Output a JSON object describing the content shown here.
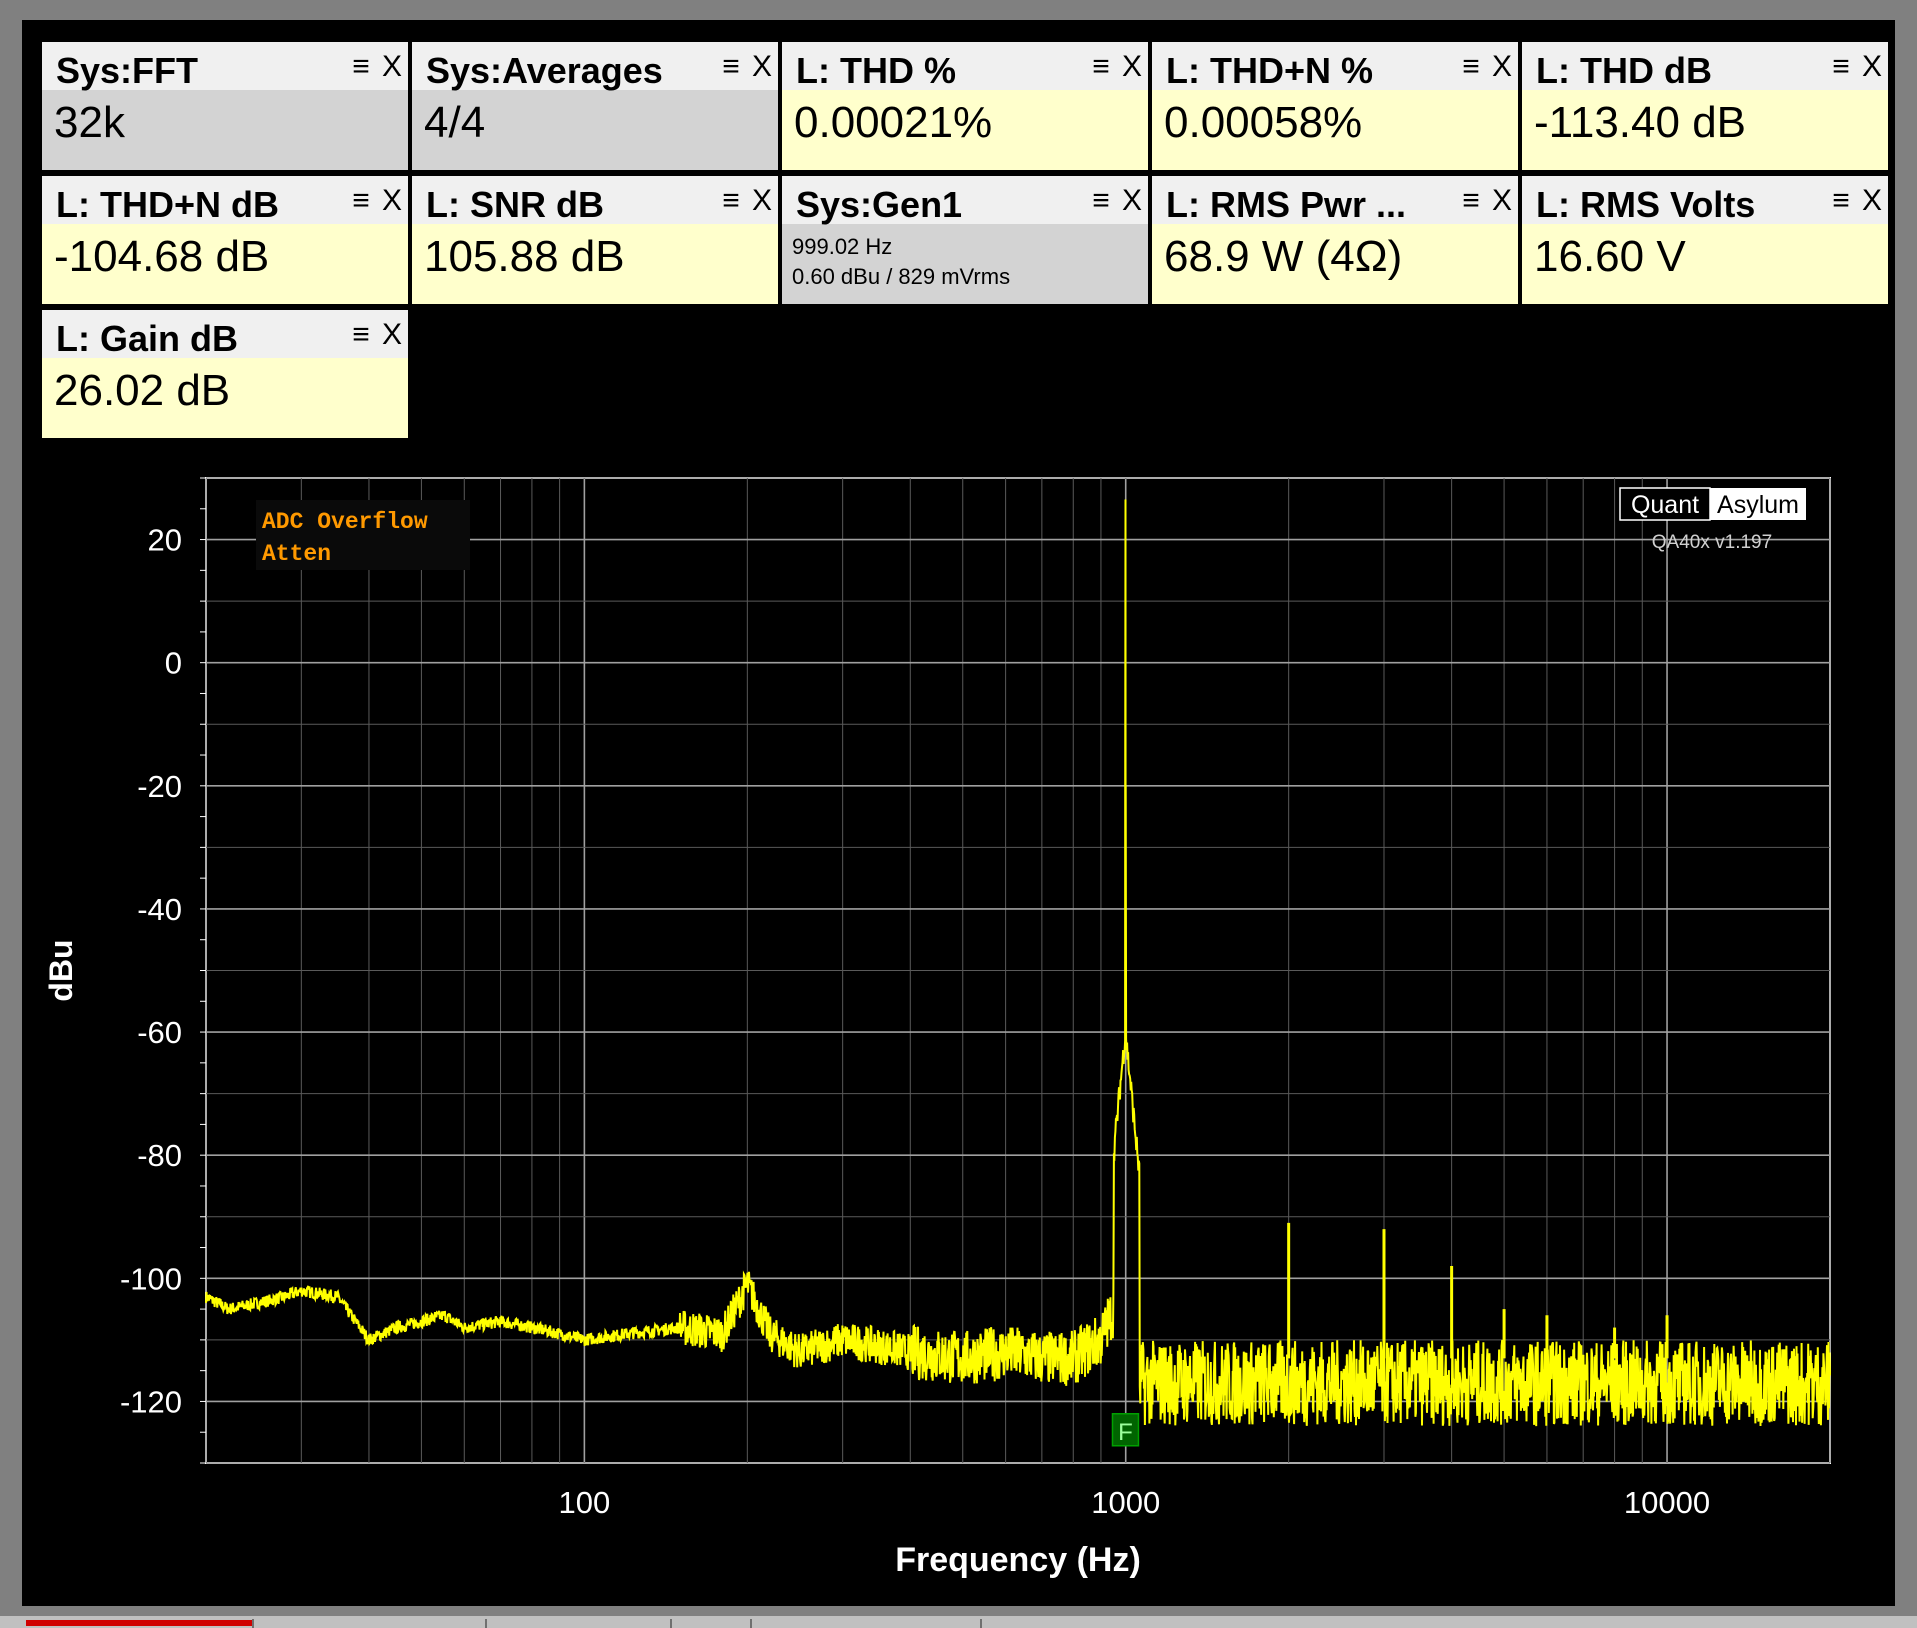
{
  "tiles": [
    {
      "title": "Sys:FFT",
      "value": "32k",
      "kind": "sys"
    },
    {
      "title": "Sys:Averages",
      "value": "4/4",
      "kind": "sys"
    },
    {
      "title": "L: THD %",
      "value": "0.00021%",
      "kind": "meas"
    },
    {
      "title": "L: THD+N %",
      "value": "0.00058%",
      "kind": "meas"
    },
    {
      "title": "L: THD dB",
      "value": "-113.40 dB",
      "kind": "meas"
    },
    {
      "title": "L: THD+N dB",
      "value": "-104.68 dB",
      "kind": "meas"
    },
    {
      "title": "L: SNR dB",
      "value": "105.88 dB",
      "kind": "meas"
    },
    {
      "title": "Sys:Gen1",
      "line1": "999.02 Hz",
      "line2": "0.60 dBu  / 829 mVrms",
      "kind": "sys"
    },
    {
      "title": "L: RMS Pwr ...",
      "value": "68.9 W (4Ω)",
      "kind": "meas"
    },
    {
      "title": "L: RMS Volts",
      "value": "16.60 V",
      "kind": "meas"
    },
    {
      "title": "L: Gain dB",
      "value": "26.02 dB",
      "kind": "meas"
    }
  ],
  "tile_icons": {
    "menu": "menu-icon",
    "close": "close-icon",
    "menu_glyph": "≡",
    "close_glyph": "X"
  },
  "chart_data": {
    "type": "line",
    "xlabel": "Frequency (Hz)",
    "ylabel": "dBu",
    "xscale": "log",
    "xlim": [
      20,
      20000
    ],
    "ylim": [
      -130,
      30
    ],
    "xticks": [
      100,
      1000,
      10000
    ],
    "xtick_labels": [
      "100",
      "1000",
      "10000"
    ],
    "yticks": [
      20,
      0,
      -20,
      -40,
      -60,
      -80,
      -100,
      -120
    ],
    "ytick_labels": [
      "20",
      "0",
      "-20",
      "-40",
      "-60",
      "-80",
      "-100",
      "-120"
    ],
    "grid": true,
    "series": [
      {
        "color": "#ffff00",
        "noise_floor": [
          [
            20,
            -103
          ],
          [
            22,
            -105
          ],
          [
            25,
            -104
          ],
          [
            28,
            -103
          ],
          [
            30,
            -102
          ],
          [
            35,
            -103
          ],
          [
            40,
            -110
          ],
          [
            45,
            -108
          ],
          [
            50,
            -107
          ],
          [
            55,
            -106
          ],
          [
            60,
            -108
          ],
          [
            70,
            -107
          ],
          [
            80,
            -108
          ],
          [
            90,
            -109
          ],
          [
            100,
            -110
          ],
          [
            120,
            -109
          ],
          [
            150,
            -108
          ],
          [
            180,
            -109
          ],
          [
            200,
            -101
          ],
          [
            220,
            -109
          ],
          [
            250,
            -112
          ],
          [
            300,
            -110
          ],
          [
            350,
            -111
          ],
          [
            400,
            -112
          ],
          [
            500,
            -113
          ],
          [
            600,
            -112
          ],
          [
            700,
            -113
          ],
          [
            800,
            -113
          ],
          [
            900,
            -110
          ],
          [
            950,
            -105
          ]
        ],
        "fundamental": {
          "freq": 999.02,
          "level": 26.5
        },
        "harmonics": [
          [
            2000,
            -91
          ],
          [
            3000,
            -92
          ],
          [
            4000,
            -98
          ],
          [
            5000,
            -105
          ],
          [
            6000,
            -106
          ],
          [
            8000,
            -108
          ],
          [
            10000,
            -106
          ]
        ],
        "high_floor": -117
      }
    ],
    "overlay_labels": [
      "ADC Overflow",
      "Atten"
    ],
    "marker": {
      "label": "F",
      "freq": 999.02
    },
    "logo": {
      "part1": "Quant",
      "part2": "Asylum",
      "version": "QA40x v1.197"
    }
  }
}
